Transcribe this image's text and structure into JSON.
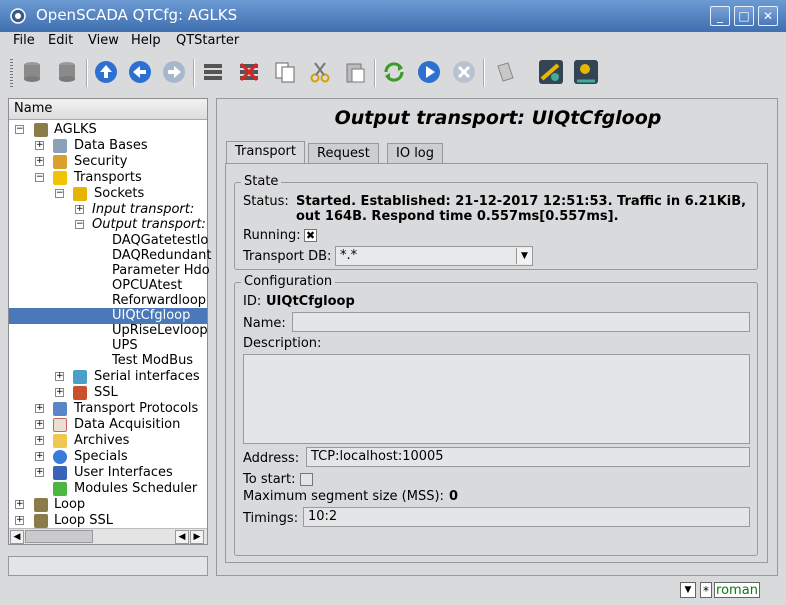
{
  "window": {
    "title": "OpenSCADA QTCfg: AGLKS",
    "buttons": [
      "_",
      "□",
      "✕"
    ]
  },
  "menu": {
    "file": "File",
    "edit": "Edit",
    "view": "View",
    "help": "Help",
    "qtstarter": "QTStarter"
  },
  "toolbar": {
    "icons": [
      "db-load-icon",
      "db-save-icon",
      "up-icon",
      "back-icon",
      "forward-icon",
      "add-item-icon",
      "delete-item-icon",
      "copy-icon",
      "cut-icon",
      "paste-icon",
      "refresh-icon",
      "start-icon",
      "stop-icon",
      "page-icon",
      "tool1-icon",
      "tool2-icon"
    ]
  },
  "tree": {
    "header": "Name",
    "root": "AGLKS",
    "data_bases": "Data Bases",
    "security": "Security",
    "transports": "Transports",
    "sockets": "Sockets",
    "input_transport": "Input transport:",
    "output_transport": "Output transport:",
    "out_items": [
      "DAQGatetestlo",
      "DAQRedundant",
      "Parameter Hdo",
      "OPCUAtest",
      "Reforwardloop",
      "UIQtCfgloop",
      "UpRiseLevloop",
      "UPS",
      "Test ModBus"
    ],
    "serial_interfaces": "Serial interfaces",
    "ssl": "SSL",
    "transport_protocols": "Transport Protocols",
    "data_acquisition": "Data Acquisition",
    "archives": "Archives",
    "specials": "Specials",
    "user_interfaces": "User Interfaces",
    "modules_scheduler": "Modules Scheduler",
    "loop": "Loop",
    "loop_ssl": "Loop SSL"
  },
  "page": {
    "title": "Output transport: UIQtCfgloop",
    "tabs": [
      "Transport",
      "Request",
      "IO log"
    ],
    "state": {
      "group": "State",
      "status_label": "Status:",
      "status_line1": "Started. Established: 21-12-2017 12:51:53. Traffic in 6.21KiB,",
      "status_line2": "out 164B. Respond time 0.557ms[0.557ms].",
      "running_label": "Running:",
      "running_mark": "✖",
      "transport_db_label": "Transport DB:",
      "transport_db_value": "*.*"
    },
    "config": {
      "group": "Configuration",
      "id_label": "ID:",
      "id_value": "UIQtCfgloop",
      "name_label": "Name:",
      "name_value": "",
      "description_label": "Description:",
      "description_value": "",
      "address_label": "Address:",
      "address_value": "TCP:localhost:10005",
      "to_start_label": "To start:",
      "mss_label": "Maximum segment size (MSS):",
      "mss_value": "0",
      "timings_label": "Timings:",
      "timings_value": "10:2"
    }
  },
  "statusbar": {
    "star": "*",
    "user": "roman"
  }
}
